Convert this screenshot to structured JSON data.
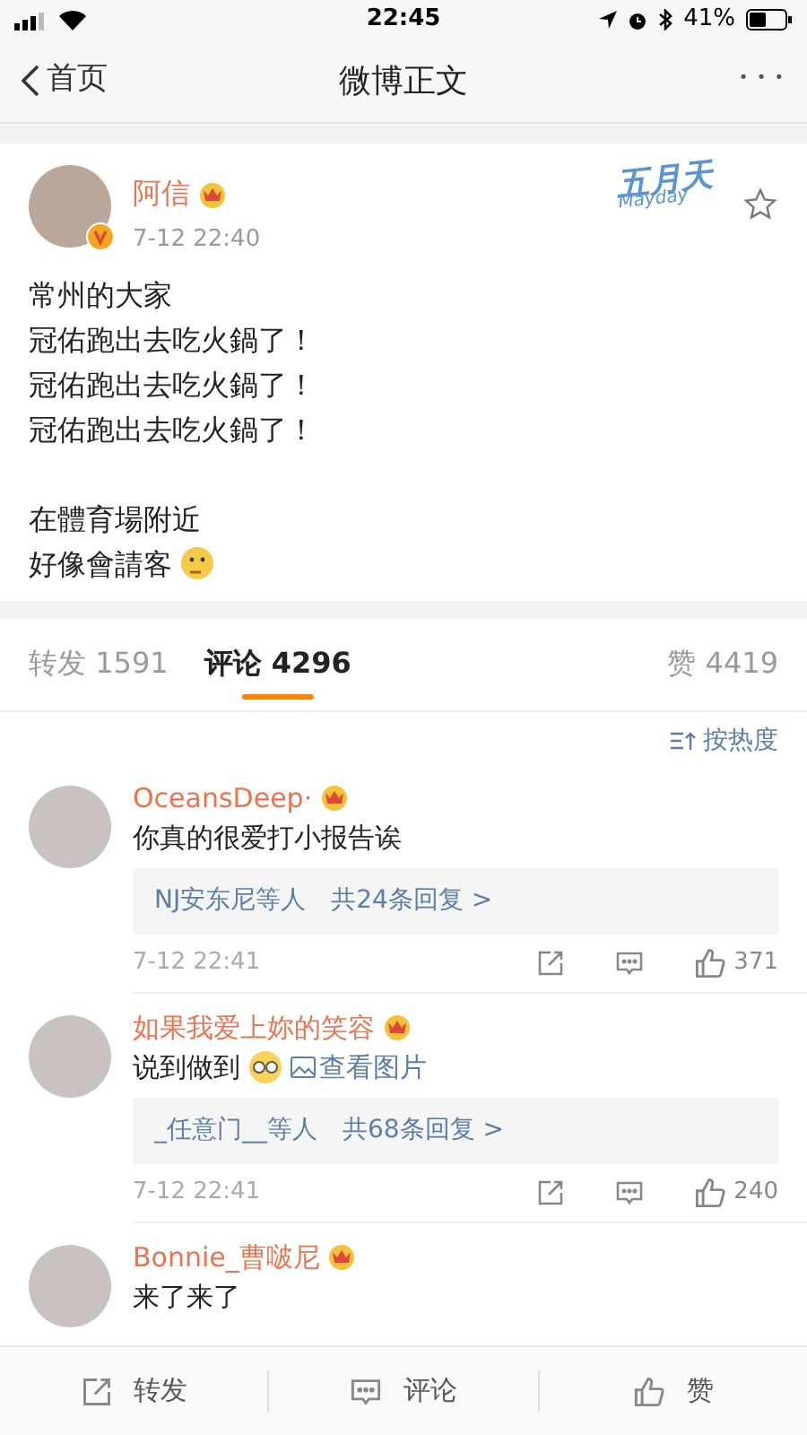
{
  "status_bar": {
    "time": "22:45",
    "battery": "41%"
  },
  "nav": {
    "back": "首页",
    "title": "微博正文",
    "more": "• • •"
  },
  "post": {
    "author": "阿信",
    "time": "7-12 22:40",
    "card_logo": {
      "title": "五月天",
      "subtitle": "Mayday"
    },
    "paragraphs": [
      [
        "常州的大家",
        "冠佑跑出去吃火鍋了！",
        "冠佑跑出去吃火鍋了！",
        "冠佑跑出去吃火鍋了！"
      ],
      [
        "在體育場附近",
        "好像會請客"
      ]
    ],
    "emoji": {
      "kind": "thinking"
    }
  },
  "tabs": [
    {
      "label": "转发",
      "count": "1591",
      "selected": false
    },
    {
      "label": "评论",
      "count": "4296",
      "selected": true
    },
    {
      "label": "赞",
      "count": "4419",
      "selected": false
    }
  ],
  "sort": "按热度",
  "comments": [
    {
      "name": "OceansDeep·",
      "text": "你真的很爱打小报告诶",
      "replies_who": "NJ安东尼等人",
      "replies_count": "共24条回复 >",
      "time": "7-12 22:41",
      "likes": "371"
    },
    {
      "name": "如果我爱上妳的笑容",
      "text": "说到做到",
      "emoji": {
        "kind": "glasses"
      },
      "image_link": "查看图片",
      "replies_who": "_任意门__等人",
      "replies_count": "共68条回复 >",
      "time": "7-12 22:41",
      "likes": "240"
    },
    {
      "name": "Bonnie_曹啵尼",
      "text": "来了来了"
    }
  ],
  "bottom_bar": [
    {
      "kind": "repost",
      "label": "转发"
    },
    {
      "kind": "comment",
      "label": "评论"
    },
    {
      "kind": "like",
      "label": "赞"
    }
  ]
}
